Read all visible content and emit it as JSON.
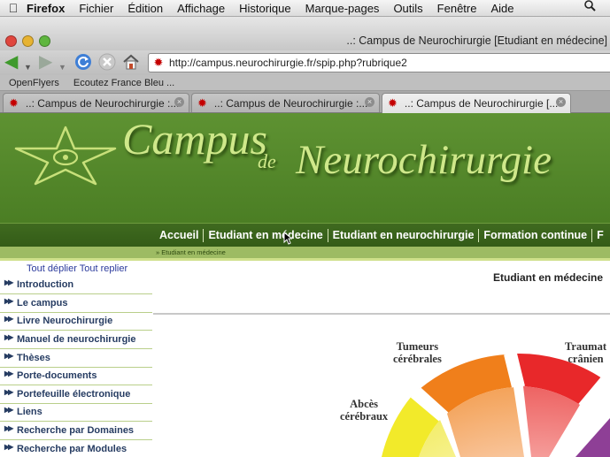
{
  "menubar": {
    "apple_icon": "apple-icon",
    "app_name": "Firefox",
    "items": [
      "Fichier",
      "Édition",
      "Affichage",
      "Historique",
      "Marque-pages",
      "Outils",
      "Fenêtre",
      "Aide"
    ],
    "spotlight_icon": "magnifier-icon"
  },
  "window": {
    "title": "..: Campus de Neurochirurgie [Etudiant en médecine]",
    "url": "http://campus.neurochirurgie.fr/spip.php?rubrique2"
  },
  "bookmarks": [
    "OpenFlyers",
    "Ecoutez France Bleu ..."
  ],
  "tabs": [
    {
      "label": "..: Campus de Neurochirurgie :..."
    },
    {
      "label": "..: Campus de Neurochirurgie :..."
    },
    {
      "label": "..: Campus de Neurochirurgie [..."
    }
  ],
  "site": {
    "title_main": "Campus",
    "title_de": "de",
    "title_neuro": "Neurochirurgie",
    "nav": [
      "Accueil",
      "Etudiant en médecine",
      "Etudiant en neurochirurgie",
      "Formation continue",
      "F"
    ],
    "breadcrumb": "» Etudiant en médecine",
    "sidebar_toggle": "Tout déplier Tout replier",
    "sidebar_items": [
      "Introduction",
      "Le campus",
      "Livre Neurochirurgie",
      "Manuel de neurochirurgie",
      "Thèses",
      "Porte-documents",
      "Portefeuille électronique",
      "Liens",
      "Recherche par Domaines",
      "Recherche par Modules"
    ],
    "page_title": "Etudiant en médecine",
    "wheel_labels": [
      {
        "line1": "Tumeurs",
        "line2": "cérébrales"
      },
      {
        "line1": "Traumat",
        "line2": "crânien"
      },
      {
        "line1": "Abcès",
        "line2": "cérébraux"
      }
    ]
  },
  "colors": {
    "banner_green": "#55892b",
    "nav_green": "#3a6420",
    "title_green": "#cfe88a",
    "sidebar_text": "#263c62",
    "wheel_orange": "#f07f1b",
    "wheel_red": "#e8282a",
    "wheel_yellow": "#f2ea2a",
    "wheel_purple": "#8e3f96"
  }
}
